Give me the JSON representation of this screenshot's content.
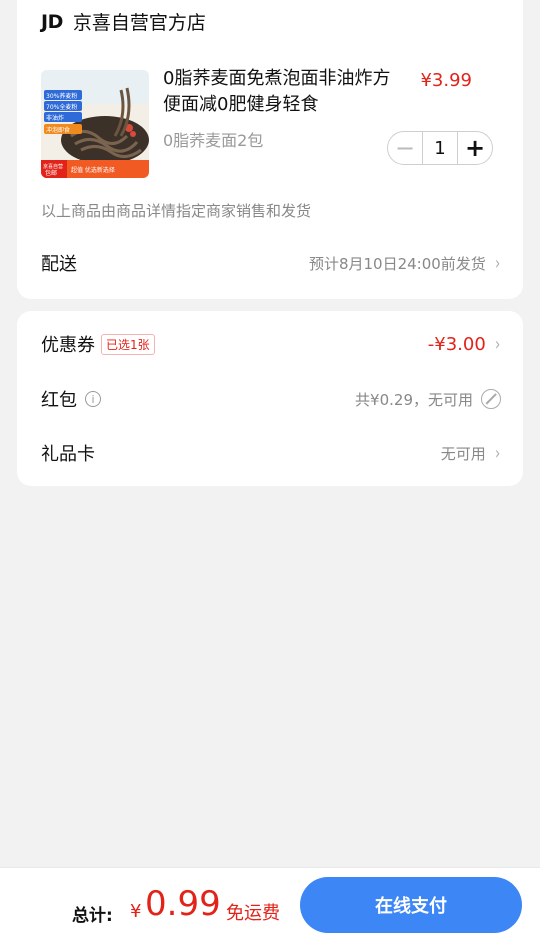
{
  "store": {
    "logo": "JD",
    "name": "京喜自营官方店"
  },
  "product": {
    "title": "0脂荞麦面免煮泡面非油炸方便面减0肥健身轻食",
    "price": "¥3.99",
    "spec": "0脂荞麦面2包",
    "quantity": "1",
    "minus_symbol": "−",
    "plus_symbol": "+",
    "thumb_texts": [
      "30%荞麦粉",
      "70%全麦粉",
      "非油炸",
      "冲泡即食",
      "京喜自营",
      "包邮",
      "超值 优选新选择"
    ]
  },
  "seller_note": "以上商品由商品详情指定商家销售和发货",
  "delivery": {
    "label": "配送",
    "value": "预计8月10日24:00前发货"
  },
  "coupon": {
    "label": "优惠券",
    "badge": "已选1张",
    "value": "-¥3.00"
  },
  "redpacket": {
    "label": "红包",
    "info_symbol": "i",
    "value": "共¥0.29，无可用"
  },
  "giftcard": {
    "label": "礼品卡",
    "value": "无可用"
  },
  "chevron": "›",
  "footer": {
    "total_label": "总计:",
    "currency": "¥",
    "amount": "0.99",
    "free_shipping": "免运费",
    "pay_button": "在线支付"
  },
  "colors": {
    "price_red": "#e2231a",
    "pay_blue": "#3c86f6",
    "background": "#f2f2f2"
  },
  "icons": [
    "jd-logo",
    "info-icon",
    "ban-icon",
    "chevron-right-icon"
  ]
}
